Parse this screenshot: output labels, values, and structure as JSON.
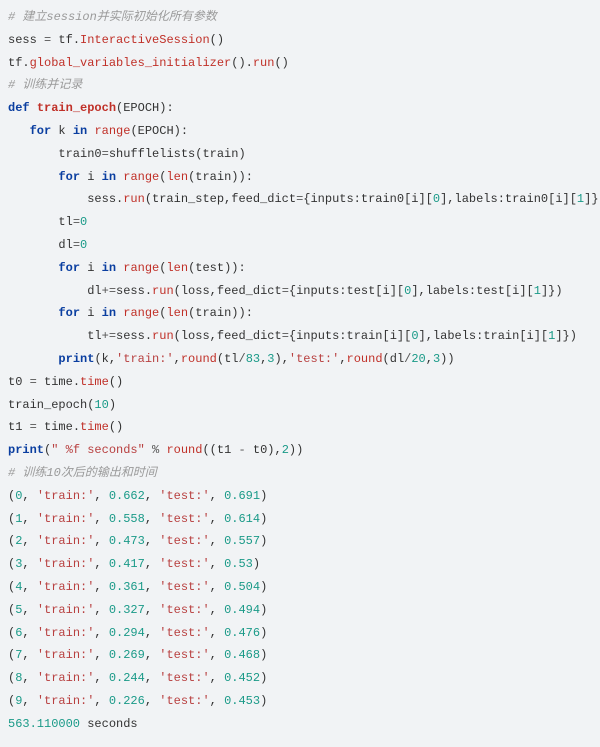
{
  "code": {
    "c1": "# 建立session并实际初始化所有参数",
    "l1a": "sess ",
    "l1b": "=",
    "l1c": " tf.",
    "l1d": "InteractiveSession",
    "l1e": "()",
    "l2a": "tf.",
    "l2b": "global_variables_initializer",
    "l2c": "().",
    "l2d": "run",
    "l2e": "()",
    "c2": "# 训练并记录",
    "l3a": "def",
    "l3b": " ",
    "l3c": "train_epoch",
    "l3d": "(EPOCH):",
    "l4a": "   ",
    "l4b": "for",
    "l4c": " k ",
    "l4d": "in",
    "l4e": " ",
    "l4f": "range",
    "l4g": "(EPOCH):",
    "l5a": "       train0",
    "l5b": "=",
    "l5c": "shufflelists(train)",
    "l6a": "       ",
    "l6b": "for",
    "l6c": " i ",
    "l6d": "in",
    "l6e": " ",
    "l6f": "range",
    "l6g": "(",
    "l6h": "len",
    "l6i": "(train)):",
    "l7a": "           sess.",
    "l7b": "run",
    "l7c": "(train_step,feed_dict",
    "l7d": "=",
    "l7e": "{inputs:train0[i][",
    "l7f": "0",
    "l7g": "],labels:train0[i][",
    "l7h": "1",
    "l7i": "]})",
    "l8a": "       tl",
    "l8b": "=",
    "l8c": "0",
    "l9a": "       dl",
    "l9b": "=",
    "l9c": "0",
    "l10a": "       ",
    "l10b": "for",
    "l10c": " i ",
    "l10d": "in",
    "l10e": " ",
    "l10f": "range",
    "l10g": "(",
    "l10h": "len",
    "l10i": "(test)):",
    "l11a": "           dl",
    "l11b": "+=",
    "l11c": "sess.",
    "l11d": "run",
    "l11e": "(loss,feed_dict",
    "l11f": "=",
    "l11g": "{inputs:test[i][",
    "l11h": "0",
    "l11i": "],labels:test[i][",
    "l11j": "1",
    "l11k": "]})",
    "l12a": "       ",
    "l12b": "for",
    "l12c": " i ",
    "l12d": "in",
    "l12e": " ",
    "l12f": "range",
    "l12g": "(",
    "l12h": "len",
    "l12i": "(train)):",
    "l13a": "           tl",
    "l13b": "+=",
    "l13c": "sess.",
    "l13d": "run",
    "l13e": "(loss,feed_dict",
    "l13f": "=",
    "l13g": "{inputs:train[i][",
    "l13h": "0",
    "l13i": "],labels:train[i][",
    "l13j": "1",
    "l13k": "]})",
    "l14a": "       ",
    "l14b": "print",
    "l14c": "(k,",
    "l14d": "'train:'",
    "l14e": ",",
    "l14f": "round",
    "l14g": "(tl",
    "l14h": "/",
    "l14i": "83",
    "l14j": ",",
    "l14k": "3",
    "l14l": "),",
    "l14m": "'test:'",
    "l14n": ",",
    "l14o": "round",
    "l14p": "(dl",
    "l14q": "/",
    "l14r": "20",
    "l14s": ",",
    "l14t": "3",
    "l14u": "))",
    "l15a": "t0 ",
    "l15b": "=",
    "l15c": " time.",
    "l15d": "time",
    "l15e": "()",
    "l16a": "train_epoch(",
    "l16b": "10",
    "l16c": ")",
    "l17a": "t1 ",
    "l17b": "=",
    "l17c": " time.",
    "l17d": "time",
    "l17e": "()",
    "l18a": "print",
    "l18b": "(",
    "l18c": "\" %f seconds\"",
    "l18d": " ",
    "l18e": "%",
    "l18f": " ",
    "l18g": "round",
    "l18h": "((t1 ",
    "l18i": "-",
    "l18j": " t0),",
    "l18k": "2",
    "l18l": "))",
    "c3": "# 训练10次后的输出和时间"
  },
  "output": {
    "rows": [
      {
        "k": "0",
        "tr": "0.662",
        "te": "0.691"
      },
      {
        "k": "1",
        "tr": "0.558",
        "te": "0.614"
      },
      {
        "k": "2",
        "tr": "0.473",
        "te": "0.557"
      },
      {
        "k": "3",
        "tr": "0.417",
        "te": "0.53"
      },
      {
        "k": "4",
        "tr": "0.361",
        "te": "0.504"
      },
      {
        "k": "5",
        "tr": "0.327",
        "te": "0.494"
      },
      {
        "k": "6",
        "tr": "0.294",
        "te": "0.476"
      },
      {
        "k": "7",
        "tr": "0.269",
        "te": "0.468"
      },
      {
        "k": "8",
        "tr": "0.244",
        "te": "0.452"
      },
      {
        "k": "9",
        "tr": "0.226",
        "te": "0.453"
      }
    ],
    "str_train": "'train:'",
    "str_test": "'test:'",
    "sep": ", ",
    "final_num": "563.110000",
    "final_txt": " seconds"
  }
}
